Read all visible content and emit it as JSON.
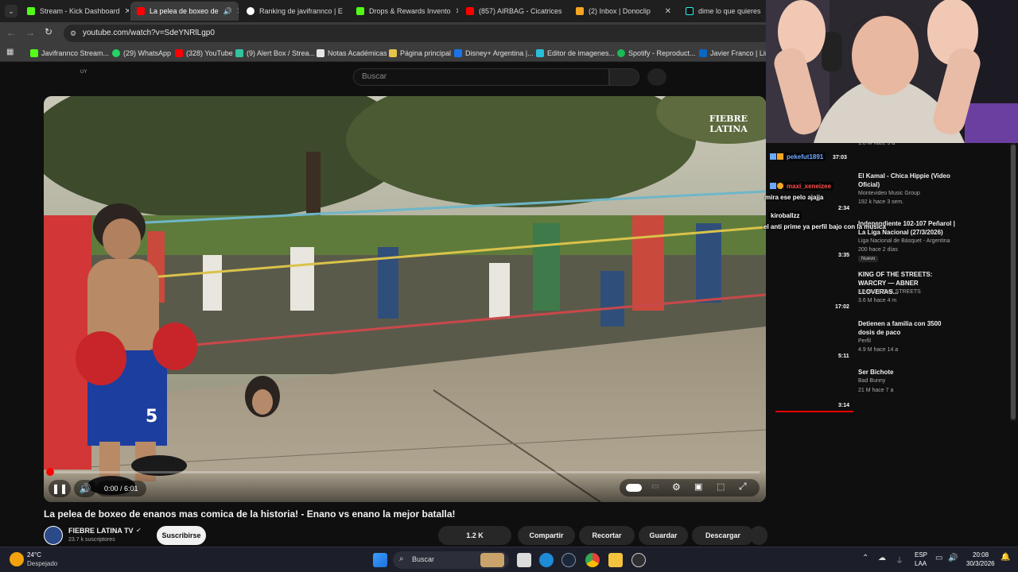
{
  "tabs": [
    {
      "label": "Stream - Kick Dashboard",
      "color": "#53fc18"
    },
    {
      "label": "La pelea de boxeo de",
      "color": "#ff0000",
      "active": true
    },
    {
      "label": "Ranking de javifrannco | E",
      "color": "#ffffff"
    },
    {
      "label": "Drops & Rewards Invento",
      "color": "#53fc18"
    },
    {
      "label": "(857) AIRBAG - Cicatrices",
      "color": "#ff0000"
    },
    {
      "label": "(2) Inbox | Donoclip",
      "color": "#f5a623"
    },
    {
      "label": "dime lo que quieres",
      "color": "#111111"
    }
  ],
  "address": {
    "url": "youtube.com/watch?v=SdeYNRlLgp0"
  },
  "bookmarks": [
    {
      "label": "Javifrannco Stream...",
      "color": "#53fc18"
    },
    {
      "label": "(29) WhatsApp",
      "color": "#25d366"
    },
    {
      "label": "(328) YouTube",
      "color": "#ff0000"
    },
    {
      "label": "(9) Alert Box / Strea...",
      "color": "#31c3a2"
    },
    {
      "label": "Notas Académicas",
      "color": "#e6e6e6"
    },
    {
      "label": "Página principal",
      "color": "#e8c34a"
    },
    {
      "label": "Disney+ Argentina |...",
      "color": "#1a73e8"
    },
    {
      "label": "Editor de imagenes...",
      "color": "#28c0d8"
    },
    {
      "label": "Spotify - Reproduct...",
      "color": "#1db954"
    },
    {
      "label": "Javier Franco | Link",
      "color": "#0a66c2"
    }
  ],
  "youtube": {
    "country": "UY",
    "search_placeholder": "Buscar",
    "video": {
      "watermark_line1": "FIEBRE",
      "watermark_line2": "LATINA",
      "current_time": "0:00",
      "duration": "6:01",
      "time_display": "0:00 / 6:01",
      "progress": 0.0
    },
    "title": "La pelea de boxeo de enanos mas comica de la historia! - Enano vs enano la mejor batalla!",
    "channel": {
      "name": "FIEBRE LATINA TV",
      "subscribers": "23.7 k suscriptores"
    },
    "actions": {
      "subscribe": "Suscribirse",
      "likes": "1.2 K",
      "share": "Compartir",
      "clip": "Recortar",
      "save": "Guardar",
      "download": "Descargar"
    },
    "recommendations": [
      {
        "title": "",
        "channel": "",
        "meta": "1.8 M   hace 5 a",
        "duration": "37:03"
      },
      {
        "title": "El Kamal - Chica Hippie (Video Oficial)",
        "channel": "Montevideo Music Group",
        "meta": "192 k   hace 3 sem.",
        "duration": "2:34"
      },
      {
        "title": "Independiente 102-107 Peñarol | La Liga Nacional (27/3/2026)",
        "channel": "Liga Nacional de Básquet - Argentina",
        "meta": "200   hace 2 días",
        "badge": "Nuevo",
        "duration": "3:35"
      },
      {
        "title": "KING OF THE STREETS: WARCRY — ABNER LLOVERAS...",
        "channel": "KING OF THE STREETS",
        "meta": "3.6 M   hace 4 m",
        "duration": "17:02"
      },
      {
        "title": "Detienen a familia con 3500 dosis de paco",
        "channel": "Perfil",
        "meta": "4.9 M   hace 14 a",
        "duration": "5:11"
      },
      {
        "title": "Ser Bichote",
        "channel": "Bad Bunny",
        "meta": "21 M   hace 7 a",
        "duration": "3:14"
      }
    ]
  },
  "chat": [
    {
      "user": "pekefut1891",
      "user_color": "#6fa8ff",
      "message": ""
    },
    {
      "user": "maxi_xeneizee",
      "user_color": "#ff4d4d",
      "message": "mira ese pelo ajajja"
    },
    {
      "user": "kiroballzz",
      "user_color": "#ffffff",
      "message": "el anti prime ya perfil bajo con la musica"
    }
  ],
  "taskbar": {
    "weather_temp": "24°C",
    "weather_desc": "Despejado",
    "search": "Buscar",
    "lang": "ESP",
    "lang2": "LAA",
    "time": "20:08",
    "date": "30/3/2026"
  }
}
